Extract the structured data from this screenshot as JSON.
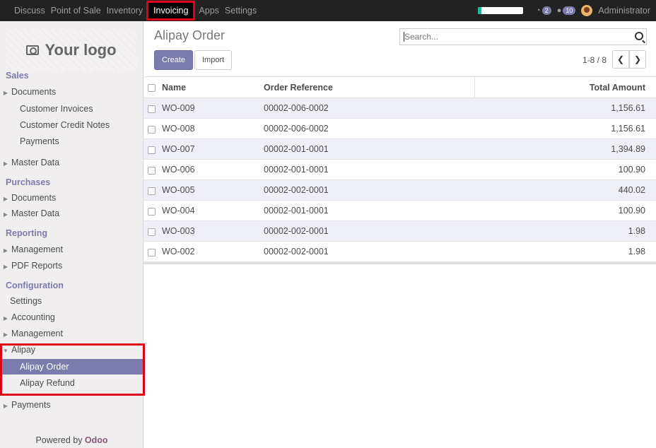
{
  "navbar": {
    "apps": [
      "Discuss",
      "Point of Sale",
      "Inventory",
      "Invoicing",
      "Apps",
      "Settings"
    ],
    "active_app": "Invoicing",
    "chat_badge": "2",
    "messages_badge": "10",
    "user": "Administrator",
    "progress": 0.08
  },
  "sidebar": {
    "logo_text": "Your logo",
    "sections": {
      "sales": "Sales",
      "purchases": "Purchases",
      "reporting": "Reporting",
      "configuration": "Configuration"
    },
    "items": {
      "sales_documents": "Documents",
      "customer_invoices": "Customer Invoices",
      "customer_credit_notes": "Customer Credit Notes",
      "payments_sub": "Payments",
      "sales_master_data": "Master Data",
      "purchases_documents": "Documents",
      "purchases_master_data": "Master Data",
      "management_reporting": "Management",
      "pdf_reports": "PDF Reports",
      "settings": "Settings",
      "accounting": "Accounting",
      "management_config": "Management",
      "alipay": "Alipay",
      "alipay_order": "Alipay Order",
      "alipay_refund": "Alipay Refund",
      "payments": "Payments"
    },
    "powered_prefix": "Powered by ",
    "powered_brand": "Odoo"
  },
  "control_panel": {
    "title": "Alipay Order",
    "create_label": "Create",
    "import_label": "Import",
    "search_placeholder": "Search...",
    "pager": "1-8 / 8"
  },
  "table": {
    "columns": [
      "Name",
      "Order Reference",
      "Total Amount"
    ],
    "rows": [
      {
        "name": "WO-009",
        "ref": "00002-006-0002",
        "amount": "1,156.61"
      },
      {
        "name": "WO-008",
        "ref": "00002-006-0002",
        "amount": "1,156.61"
      },
      {
        "name": "WO-007",
        "ref": "00002-001-0001",
        "amount": "1,394.89"
      },
      {
        "name": "WO-006",
        "ref": "00002-001-0001",
        "amount": "100.90"
      },
      {
        "name": "WO-005",
        "ref": "00002-002-0001",
        "amount": "440.02"
      },
      {
        "name": "WO-004",
        "ref": "00002-001-0001",
        "amount": "100.90"
      },
      {
        "name": "WO-003",
        "ref": "00002-002-0001",
        "amount": "1.98"
      },
      {
        "name": "WO-002",
        "ref": "00002-002-0001",
        "amount": "1.98"
      }
    ]
  },
  "colors": {
    "accent": "#7c7bad",
    "highlight": "#e0001a",
    "navbar": "#222222"
  }
}
